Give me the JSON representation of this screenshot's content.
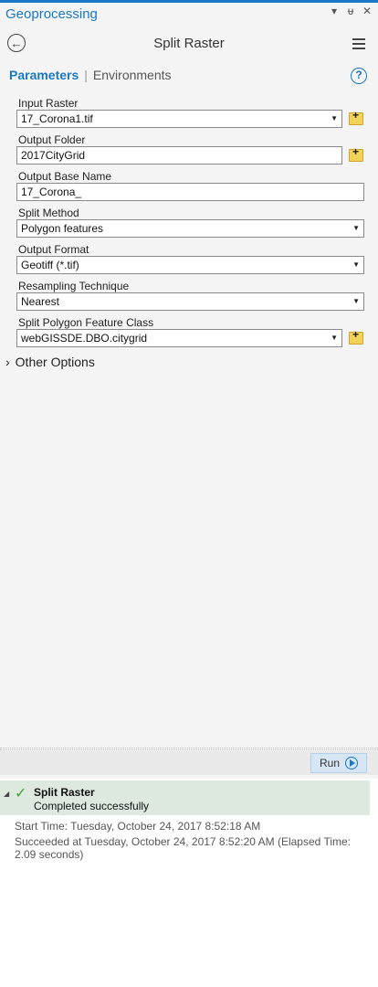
{
  "window": {
    "title": "Geoprocessing",
    "ctrl_dropdown": "▾",
    "ctrl_pin": "ᵾ",
    "ctrl_close": "✕"
  },
  "tool": {
    "title": "Split Raster"
  },
  "tabs": {
    "parameters": "Parameters",
    "separator": "|",
    "environments": "Environments"
  },
  "help": {
    "label": "?"
  },
  "params": {
    "input_raster": {
      "label": "Input Raster",
      "value": "17_Corona1.tif"
    },
    "output_folder": {
      "label": "Output Folder",
      "value": "2017CityGrid"
    },
    "output_base_name": {
      "label": "Output Base Name",
      "value": "17_Corona_"
    },
    "split_method": {
      "label": "Split Method",
      "value": "Polygon features"
    },
    "output_format": {
      "label": "Output Format",
      "value": "Geotiff (*.tif)"
    },
    "resampling": {
      "label": "Resampling Technique",
      "value": "Nearest"
    },
    "split_polygon": {
      "label": "Split Polygon Feature Class",
      "value": "webGISSDE.DBO.citygrid"
    }
  },
  "other_options": {
    "label": "Other Options",
    "chevron": "›"
  },
  "run": {
    "label": "Run"
  },
  "result": {
    "name": "Split Raster",
    "status": "Completed successfully",
    "start_time": "Start Time: Tuesday, October 24, 2017 8:52:18 AM",
    "succeeded": "Succeeded at Tuesday, October 24, 2017 8:52:20 AM (Elapsed Time: 2.09 seconds)"
  },
  "icons": {
    "back": "back-arrow-icon",
    "menu": "hamburger-menu-icon",
    "help": "help-icon",
    "folder": "folder-add-icon",
    "check": "checkmark-icon",
    "run": "play-icon"
  },
  "colors": {
    "accent": "#1a78c2",
    "success": "#3aa63a",
    "result_bg": "#dde9df",
    "run_bg": "#d6e6f5"
  }
}
